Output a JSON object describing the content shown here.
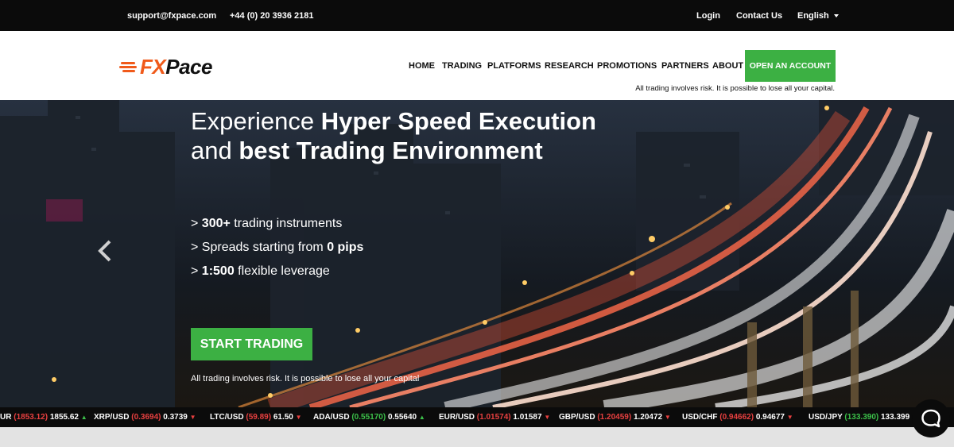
{
  "topbar": {
    "email": "support@fxpace.com",
    "phone": "+44 (0) 20 3936 2181",
    "login": "Login",
    "contact": "Contact Us",
    "language": "English"
  },
  "brand": {
    "logo_fx": "FX",
    "logo_pace": "Pace"
  },
  "nav": {
    "items": [
      "HOME",
      "TRADING",
      "PLATFORMS",
      "RESEARCH",
      "PROMOTIONS",
      "PARTNERS",
      "ABOUT"
    ],
    "cta": "OPEN AN ACCOUNT",
    "risk": "All trading involves risk. It is possible to lose all your capital."
  },
  "hero": {
    "line1_light": "Experience ",
    "line1_bold": "Hyper Speed Execution",
    "line2_light": "and ",
    "line2_bold": "best Trading Environment",
    "bullets": [
      {
        "prefix": "> ",
        "bold": "300+",
        "rest": " trading instruments"
      },
      {
        "prefix": "> Spreads starting from ",
        "bold": "0 pips",
        "rest": ""
      },
      {
        "prefix": "> ",
        "bold": "1:500",
        "rest": " flexible leverage"
      }
    ],
    "button": "START TRADING",
    "risk": "All trading involves risk. It is possible to lose all your capital"
  },
  "ticker": [
    {
      "pair": "UR",
      "bid": "(1853.12)",
      "ask": "1855.62",
      "dir": "up"
    },
    {
      "pair": "XRP/USD",
      "bid": "(0.3694)",
      "ask": "0.3739",
      "dir": "down"
    },
    {
      "pair": "LTC/USD",
      "bid": "(59.89)",
      "ask": "61.50",
      "dir": "down"
    },
    {
      "pair": "ADA/USD",
      "bid": "(0.55170)",
      "ask": "0.55640",
      "dir": "up"
    },
    {
      "pair": "EUR/USD",
      "bid": "(1.01574)",
      "ask": "1.01587",
      "dir": "down"
    },
    {
      "pair": "GBP/USD",
      "bid": "(1.20459)",
      "ask": "1.20472",
      "dir": "down"
    },
    {
      "pair": "USD/CHF",
      "bid": "(0.94662)",
      "ask": "0.94677",
      "dir": "down"
    },
    {
      "pair": "USD/JPY",
      "bid": "(133.390)",
      "ask": "133.399",
      "dir": "up"
    }
  ],
  "colors": {
    "accent_green": "#3cb043",
    "brand_orange": "#f05a1a",
    "down_red": "#e84040",
    "up_green": "#3cc14a"
  },
  "icons": {
    "carousel_prev": "chevron-left-icon",
    "chat": "chat-bubble-icon"
  }
}
